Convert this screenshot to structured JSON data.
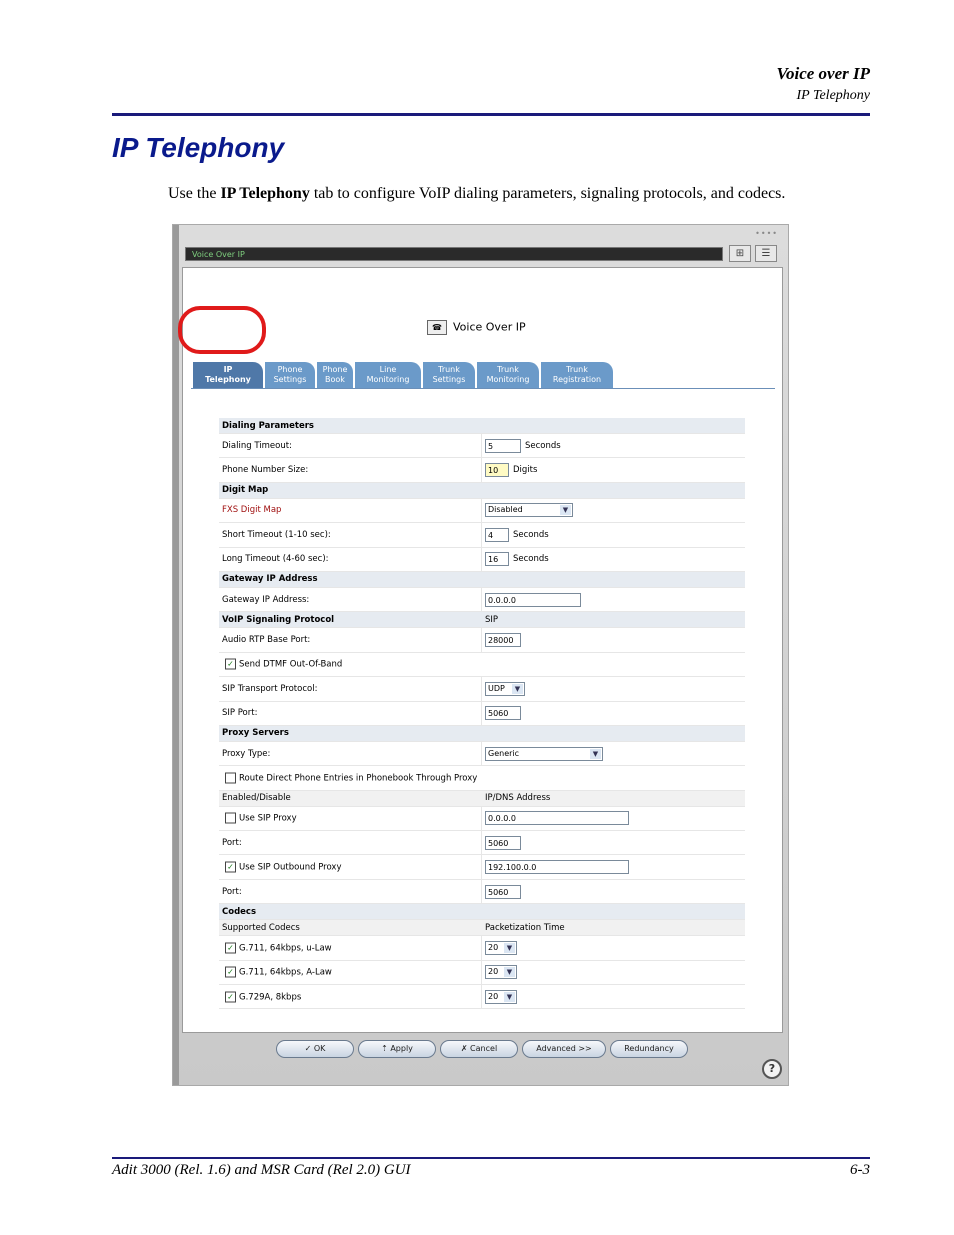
{
  "header": {
    "chapter": "Voice over IP",
    "section": "IP Telephony"
  },
  "title": "IP Telephony",
  "intro": {
    "pre": "Use the ",
    "bold": "IP Telephony",
    "post": " tab to configure VoIP dialing parameters, signaling protocols, and codecs."
  },
  "footer": {
    "left": "Adit 3000 (Rel. 1.6) and MSR Card (Rel 2.0) GUI",
    "right": "6-3"
  },
  "window": {
    "title": "Voice Over IP",
    "heading": "Voice Over IP",
    "tabs": [
      {
        "line1": "IP",
        "line2": "Telephony"
      },
      {
        "line1": "Phone",
        "line2": "Settings"
      },
      {
        "line1": "Phone",
        "line2": "Book"
      },
      {
        "line1": "Line",
        "line2": "Monitoring"
      },
      {
        "line1": "Trunk",
        "line2": "Settings"
      },
      {
        "line1": "Trunk",
        "line2": "Monitoring"
      },
      {
        "line1": "Trunk",
        "line2": "Registration"
      }
    ],
    "form": {
      "dialing_parameters": "Dialing Parameters",
      "dialing_timeout_label": "Dialing Timeout:",
      "dialing_timeout_value": "5",
      "dialing_timeout_unit": "Seconds",
      "phone_number_size_label": "Phone Number Size:",
      "phone_number_size_value": "10",
      "phone_number_size_unit": "Digits",
      "digit_map": "Digit Map",
      "fxs_digit_map_label": "FXS Digit Map",
      "fxs_digit_map_value": "Disabled",
      "short_timeout_label": "Short Timeout (1-10 sec):",
      "short_timeout_value": "4",
      "short_timeout_unit": "Seconds",
      "long_timeout_label": "Long Timeout (4-60 sec):",
      "long_timeout_value": "16",
      "long_timeout_unit": "Seconds",
      "gateway_ip_section": "Gateway IP Address",
      "gateway_ip_label": "Gateway IP Address:",
      "gateway_ip_value": "0.0.0.0",
      "voip_signaling_protocol": "VoIP Signaling Protocol",
      "voip_signaling_value": "SIP",
      "audio_rtp_label": "Audio RTP Base Port:",
      "audio_rtp_value": "28000",
      "send_dtmf_label": "Send DTMF Out-Of-Band",
      "sip_transport_label": "SIP Transport Protocol:",
      "sip_transport_value": "UDP",
      "sip_port_label": "SIP Port:",
      "sip_port_value": "5060",
      "proxy_servers": "Proxy Servers",
      "proxy_type_label": "Proxy Type:",
      "proxy_type_value": "Generic",
      "route_direct_label": "Route Direct Phone Entries in Phonebook Through Proxy",
      "enabled_disable_hdr": "Enabled/Disable",
      "ip_dns_hdr": "IP/DNS Address",
      "use_sip_proxy_label": "Use SIP Proxy",
      "use_sip_proxy_value": "0.0.0.0",
      "port1_label": "Port:",
      "port1_value": "5060",
      "use_outbound_label": "Use SIP Outbound Proxy",
      "use_outbound_value": "192.100.0.0",
      "port2_label": "Port:",
      "port2_value": "5060",
      "codecs": "Codecs",
      "supported_codecs_hdr": "Supported Codecs",
      "packetization_hdr": "Packetization Time",
      "codec_list": [
        {
          "name": "G.711, 64kbps, u-Law",
          "ptime": "20"
        },
        {
          "name": "G.711, 64kbps, A-Law",
          "ptime": "20"
        },
        {
          "name": "G.729A, 8kbps",
          "ptime": "20"
        }
      ]
    },
    "buttons": {
      "ok": "✓ OK",
      "apply": "⇡ Apply",
      "cancel": "✗ Cancel",
      "advanced": "Advanced >>",
      "redundancy": "Redundancy"
    },
    "help": "?"
  },
  "colors": {
    "accent": "#0a1a8c",
    "tab": "#6b9ac9",
    "highlight": "#e01a1a"
  }
}
